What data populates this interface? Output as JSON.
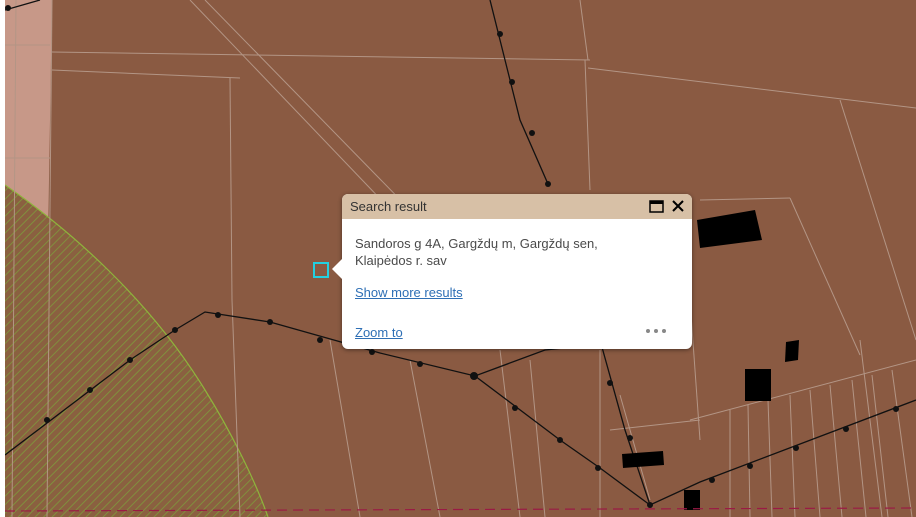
{
  "popup": {
    "title": "Search result",
    "address_line1": "Sandoros g 4A, Gargždų m, Gargždų sen,",
    "address_line2": "Klaipėdos r. sav",
    "more_results_label": "Show more results",
    "zoom_label": "Zoom to"
  },
  "icons": {
    "maximize": "maximize-icon",
    "close": "close-icon",
    "more": "more-actions-icon"
  },
  "colors": {
    "parcel_fill": "#8a5a42",
    "road_strip": "#c9998a",
    "boundary_line": "#b09080",
    "hatch_zone": "#7c8a3c",
    "hatch_border": "#8fb43c",
    "utility_line": "#111111",
    "building": "#000000",
    "dashed_boundary": "#8a1c3c",
    "search_marker": "#22d0e0",
    "popup_header": "#d7c0a6",
    "link": "#2e6fb5"
  }
}
